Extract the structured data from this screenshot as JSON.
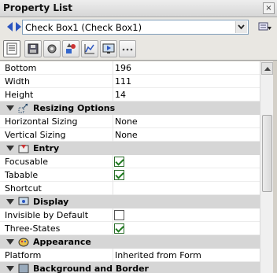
{
  "window": {
    "title": "Property List"
  },
  "object_selector": {
    "value": "Check Box1 (Check Box1)"
  },
  "tabs": [
    {
      "name": "all-properties",
      "active": true
    },
    {
      "name": "data"
    },
    {
      "name": "settings"
    },
    {
      "name": "shapes"
    },
    {
      "name": "chart"
    },
    {
      "name": "display"
    },
    {
      "name": "more"
    }
  ],
  "properties": [
    {
      "type": "prop",
      "name": "Bottom",
      "value": "196"
    },
    {
      "type": "prop",
      "name": "Width",
      "value": "111"
    },
    {
      "type": "prop",
      "name": "Height",
      "value": "14"
    },
    {
      "type": "section",
      "name": "Resizing Options",
      "icon": "resize-icon"
    },
    {
      "type": "prop",
      "name": "Horizontal Sizing",
      "value": "None"
    },
    {
      "type": "prop",
      "name": "Vertical Sizing",
      "value": "None"
    },
    {
      "type": "section",
      "name": "Entry",
      "icon": "entry-icon"
    },
    {
      "type": "check",
      "name": "Focusable",
      "checked": true
    },
    {
      "type": "check",
      "name": "Tabable",
      "checked": true
    },
    {
      "type": "prop",
      "name": "Shortcut",
      "value": ""
    },
    {
      "type": "section",
      "name": "Display",
      "icon": "display-icon"
    },
    {
      "type": "check",
      "name": "Invisible by Default",
      "checked": false
    },
    {
      "type": "check",
      "name": "Three-States",
      "checked": true
    },
    {
      "type": "section",
      "name": "Appearance",
      "icon": "appearance-icon"
    },
    {
      "type": "prop",
      "name": "Platform",
      "value": "Inherited from Form"
    },
    {
      "type": "section",
      "name": "Background and Border",
      "icon": "background-icon"
    }
  ]
}
